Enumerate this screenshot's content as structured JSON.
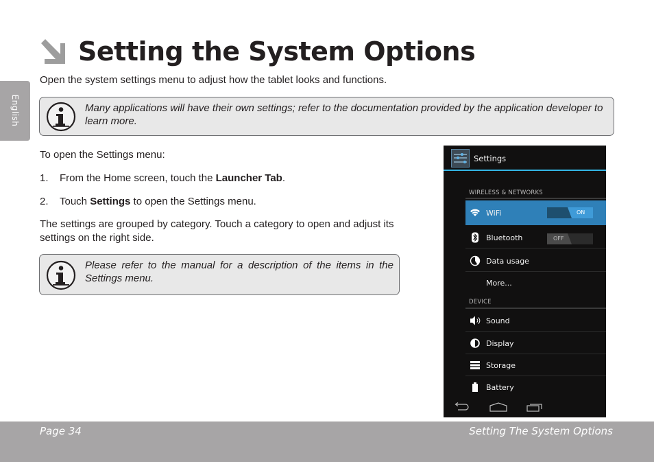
{
  "side_tab": {
    "label": "English"
  },
  "header": {
    "title": "Setting the System Options",
    "arrow_icon": "arrow-down-right-icon"
  },
  "intro": "Open the system settings menu to adjust how the tablet looks and functions.",
  "notes": [
    {
      "icon": "info-icon",
      "text": "Many applications will have their own settings; refer to the documentation provided by the application developer to learn more."
    },
    {
      "icon": "info-icon",
      "text": "Please refer to the manual for a description of the items in the Settings menu."
    }
  ],
  "body": {
    "open_heading": "To open the Settings menu:",
    "steps": [
      {
        "num": "1.",
        "before": "From the Home screen, touch the ",
        "bold": "Launcher Tab",
        "after": "."
      },
      {
        "num": "2.",
        "before": "Touch ",
        "bold": "Settings",
        "after": " to open the Settings menu."
      }
    ],
    "grouped": "The settings are grouped by category. Touch a category to open and adjust its settings on the right side."
  },
  "screenshot": {
    "action_bar_title": "Settings",
    "accent_color": "#33b5e5",
    "selected_color": "#2f80b8",
    "sections": [
      {
        "heading": "WIRELESS & NETWORKS",
        "items": [
          {
            "label": "WiFi",
            "icon": "wifi-icon",
            "selected": true,
            "toggle": "ON"
          },
          {
            "label": "Bluetooth",
            "icon": "bluetooth-icon",
            "toggle": "OFF"
          },
          {
            "label": "Data usage",
            "icon": "data-usage-icon"
          },
          {
            "label": "More...",
            "icon": ""
          }
        ]
      },
      {
        "heading": "DEVICE",
        "items": [
          {
            "label": "Sound",
            "icon": "sound-icon"
          },
          {
            "label": "Display",
            "icon": "display-icon"
          },
          {
            "label": "Storage",
            "icon": "storage-icon"
          },
          {
            "label": "Battery",
            "icon": "battery-icon"
          }
        ]
      }
    ],
    "nav": [
      "back-icon",
      "home-icon",
      "recents-icon"
    ]
  },
  "footer": {
    "page": "Page 34",
    "section": "Setting The System Options"
  }
}
